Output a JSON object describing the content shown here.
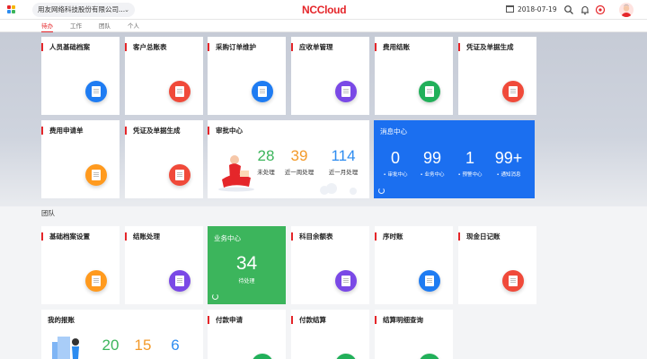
{
  "header": {
    "org_name": "用友网络科技股份有限公司...",
    "brand": "NCCloud",
    "date": "2018-07-19"
  },
  "tabs": [
    "待办",
    "工作",
    "团队",
    "个人"
  ],
  "icons": {
    "app_grid": "app-grid-icon",
    "calendar": "calendar-icon",
    "search": "search-icon",
    "bell": "bell-icon",
    "plus": "plus-circle-icon",
    "avatar": "avatar"
  },
  "colors": {
    "brand_red": "#e5262a",
    "msg_blue": "#1b6ff0",
    "biz_green": "#3cb55c"
  },
  "todo_cards": [
    {
      "title": "人员基础档案",
      "icon_color": "#1f7cf2",
      "icon": "document-icon"
    },
    {
      "title": "客户总账表",
      "icon_color": "#f04a3a",
      "icon": "ledger-icon"
    },
    {
      "title": "采购订单维护",
      "icon_color": "#1f7cf2",
      "icon": "clipboard-icon"
    },
    {
      "title": "应收单管理",
      "icon_color": "#7a49e6",
      "icon": "receivable-icon"
    },
    {
      "title": "费用结账",
      "icon_color": "#22b05a",
      "icon": "book-icon"
    },
    {
      "title": "凭证及单据生成",
      "icon_color": "#f04a3a",
      "icon": "voucher-icon"
    },
    {
      "title": "费用申请单",
      "icon_color": "#ff9a1e",
      "icon": "application-icon"
    },
    {
      "title": "凭证及单据生成",
      "icon_color": "#f04a3a",
      "icon": "voucher-icon"
    }
  ],
  "approval": {
    "title": "审批中心",
    "items": [
      {
        "value": "28",
        "label": "未处理",
        "color": "#3cb55c"
      },
      {
        "value": "39",
        "label": "近一周处理",
        "color": "#f39a2a"
      },
      {
        "value": "114",
        "label": "近一月处理",
        "color": "#2d8cf0"
      }
    ]
  },
  "message": {
    "title": "消息中心",
    "items": [
      {
        "value": "0",
        "label": "审批中心"
      },
      {
        "value": "99",
        "label": "业务中心"
      },
      {
        "value": "1",
        "label": "预警中心"
      },
      {
        "value": "99+",
        "label": "通知消息"
      }
    ]
  },
  "team_section": "团队",
  "team_cards": [
    {
      "title": "基础档案设置",
      "icon_color": "#ff9a1e",
      "icon": "archive-icon"
    },
    {
      "title": "结账处理",
      "icon_color": "#7a49e6",
      "icon": "briefcase-icon"
    },
    {
      "title": "科目余额表",
      "icon_color": "#7a49e6",
      "icon": "balance-icon"
    },
    {
      "title": "序时账",
      "icon_color": "#1f7cf2",
      "icon": "journal-icon"
    },
    {
      "title": "现金日记账",
      "icon_color": "#f04a3a",
      "icon": "cash-journal-icon"
    },
    {
      "title": "付款申请",
      "icon_color": "#22b05a",
      "icon": "payment-icon"
    },
    {
      "title": "付款结算",
      "icon_color": "#22b05a",
      "icon": "settlement-icon"
    },
    {
      "title": "结算明细查询",
      "icon_color": "#22b05a",
      "icon": "query-icon"
    }
  ],
  "business": {
    "title": "业务中心",
    "value": "34",
    "sub": "待处理"
  },
  "report": {
    "title": "我的报账",
    "items": [
      {
        "value": "20",
        "color": "#3cb55c"
      },
      {
        "value": "15",
        "color": "#f39a2a"
      },
      {
        "value": "6",
        "color": "#2d8cf0"
      }
    ]
  }
}
